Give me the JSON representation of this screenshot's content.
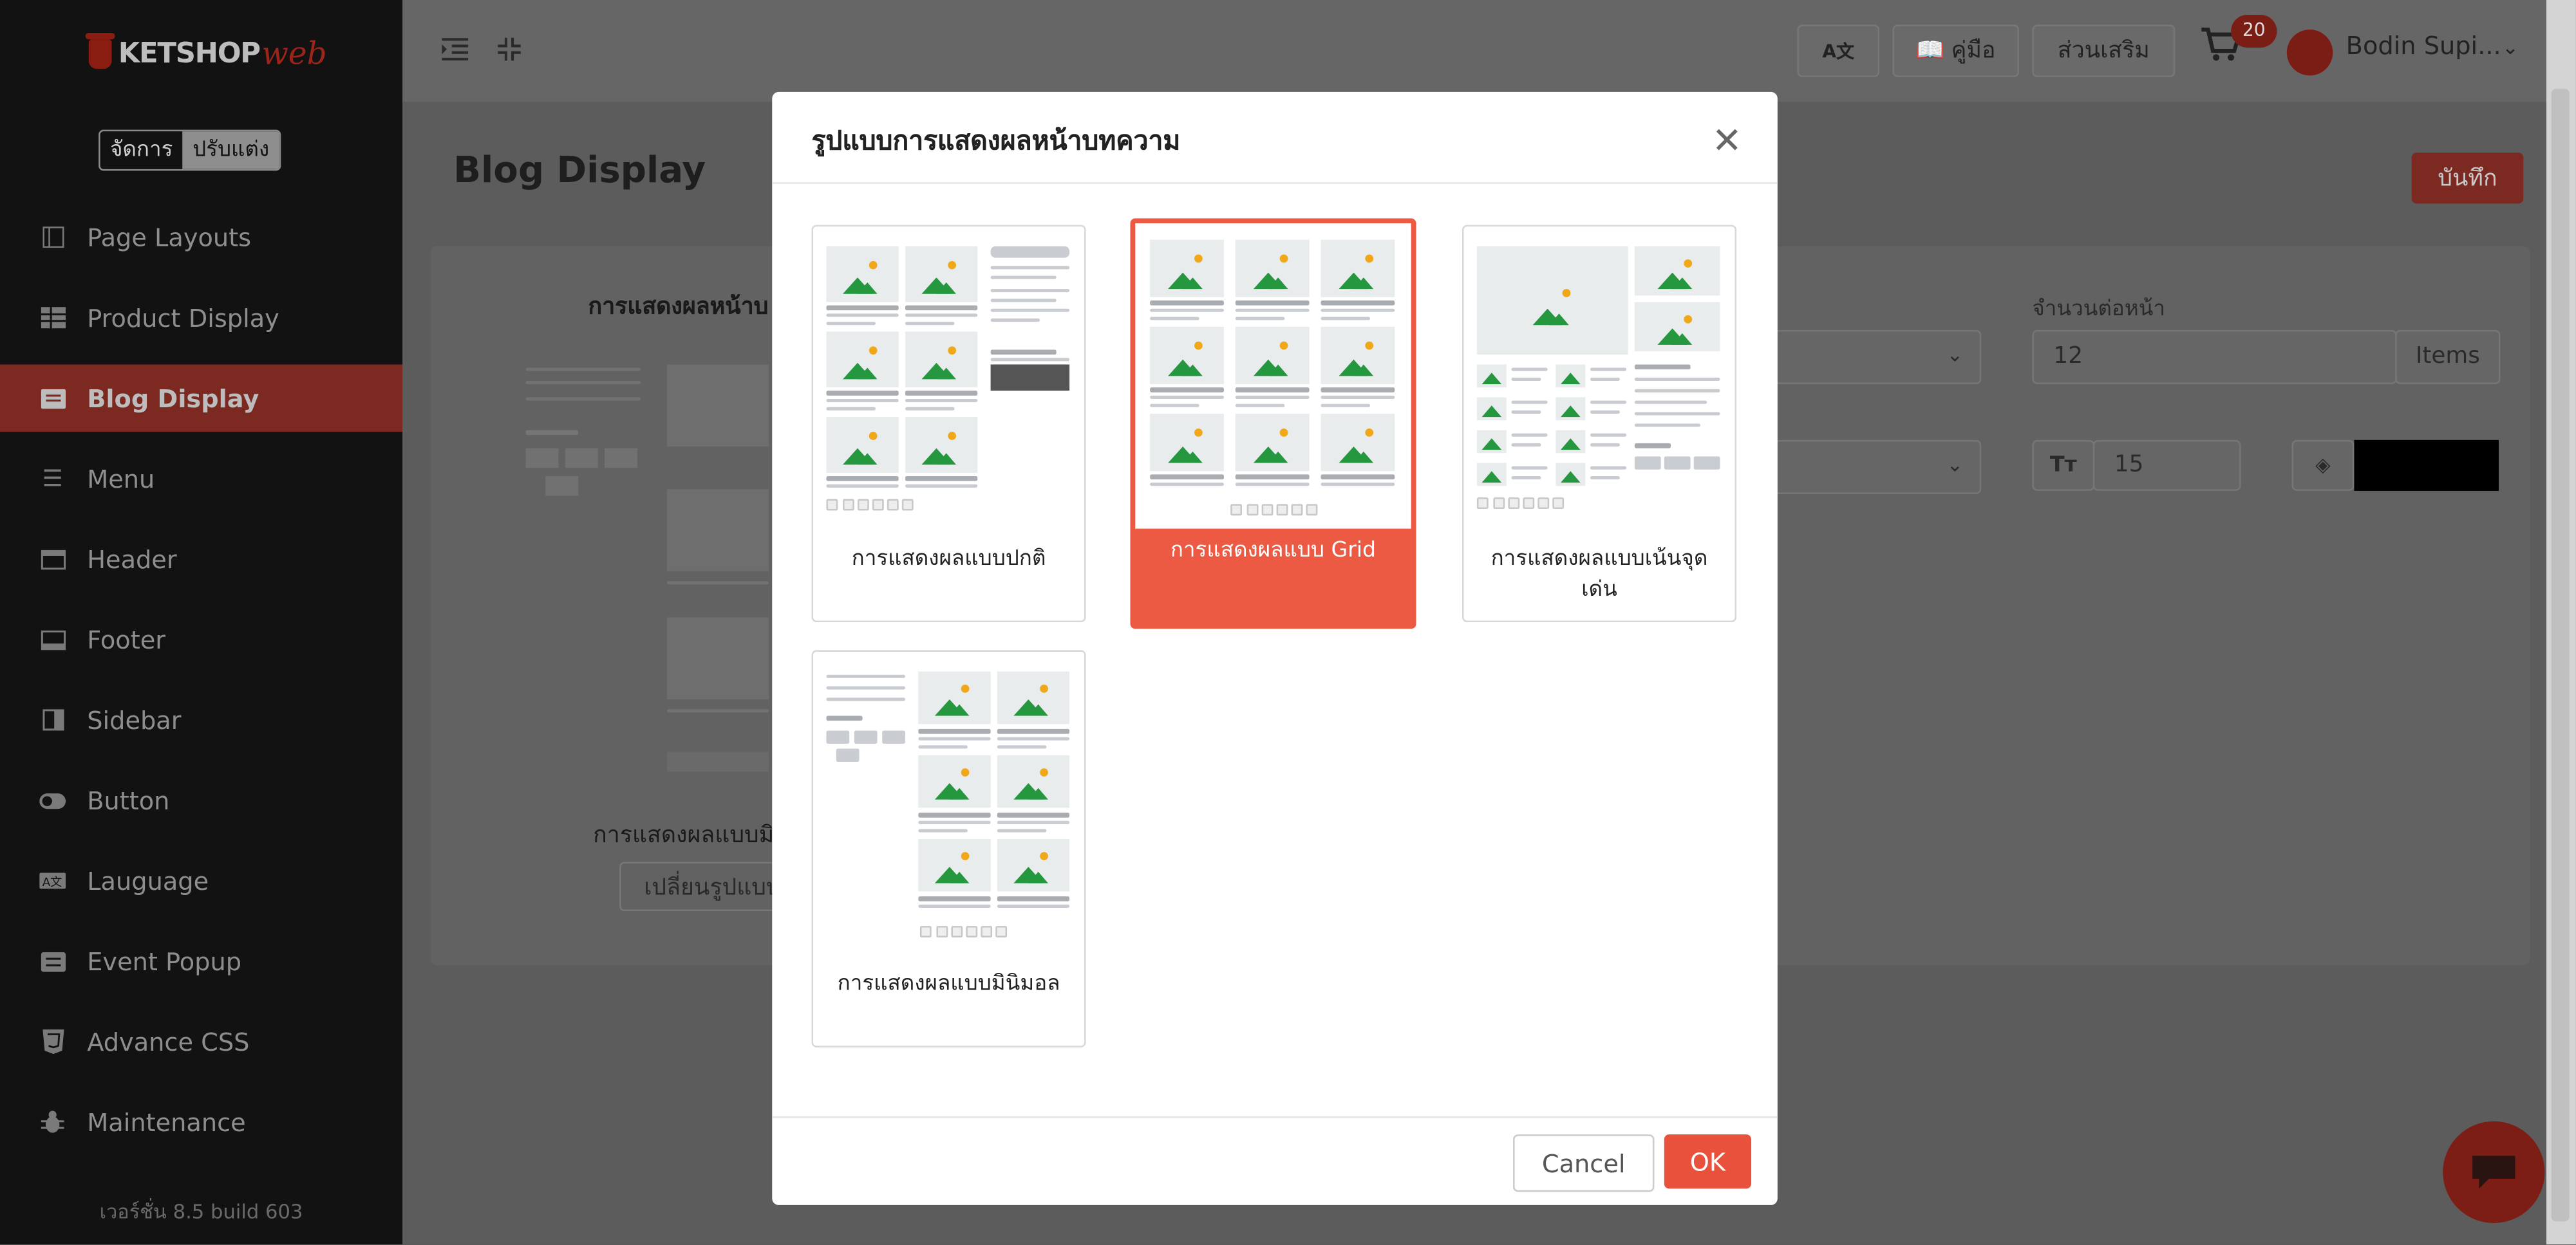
{
  "brand": {
    "logo_main": "KETSHOP",
    "logo_suffix": "web"
  },
  "mode_switch": {
    "manage": "จัดการ",
    "customize": "ปรับแต่ง"
  },
  "sidebar": {
    "items": [
      {
        "label": "Page Layouts",
        "icon": "layout-icon"
      },
      {
        "label": "Product Display",
        "icon": "grid-icon"
      },
      {
        "label": "Blog Display",
        "icon": "blog-icon",
        "active": true
      },
      {
        "label": "Menu",
        "icon": "menu-icon"
      },
      {
        "label": "Header",
        "icon": "header-icon"
      },
      {
        "label": "Footer",
        "icon": "footer-icon"
      },
      {
        "label": "Sidebar",
        "icon": "sidebar-icon"
      },
      {
        "label": "Button",
        "icon": "toggle-icon"
      },
      {
        "label": "Lauguage",
        "icon": "language-icon"
      },
      {
        "label": "Event Popup",
        "icon": "popup-icon"
      },
      {
        "label": "Advance CSS",
        "icon": "css-icon"
      },
      {
        "label": "Maintenance",
        "icon": "bug-icon"
      }
    ],
    "version": "เวอร์ชั่น 8.5 build 603"
  },
  "topbar": {
    "lang_icon": "A文",
    "manual": "คู่มือ",
    "addons": "ส่วนเสริม",
    "cart_count": "20",
    "user": "Bodin Supi..."
  },
  "page": {
    "title": "Blog Display",
    "save": "บันทึก",
    "section_title": "การแสดงผลหน้าบ",
    "current_style": "การแสดงผลแบบมิ",
    "change_button": "เปลี่ยนรูปแบบ",
    "per_page_label": "จำนวนต่อหน้า",
    "per_page_value": "12",
    "per_page_unit": "Items",
    "font_size_value": "15",
    "color_value": "#000000"
  },
  "modal": {
    "title": "รูปแบบการแสดงผลหน้าบทความ",
    "options": [
      {
        "label": "การแสดงผลแบบปกติ",
        "selected": false
      },
      {
        "label": "การแสดงผลแบบ Grid",
        "selected": true
      },
      {
        "label": "การแสดงผลแบบเน้นจุดเด่น",
        "selected": false
      },
      {
        "label": "การแสดงผลแบบมินิมอล",
        "selected": false
      }
    ],
    "cancel": "Cancel",
    "ok": "OK"
  },
  "colors": {
    "accent": "#e8523d",
    "selected_border": "#ec5a44",
    "sidebar_bg": "#121212"
  }
}
